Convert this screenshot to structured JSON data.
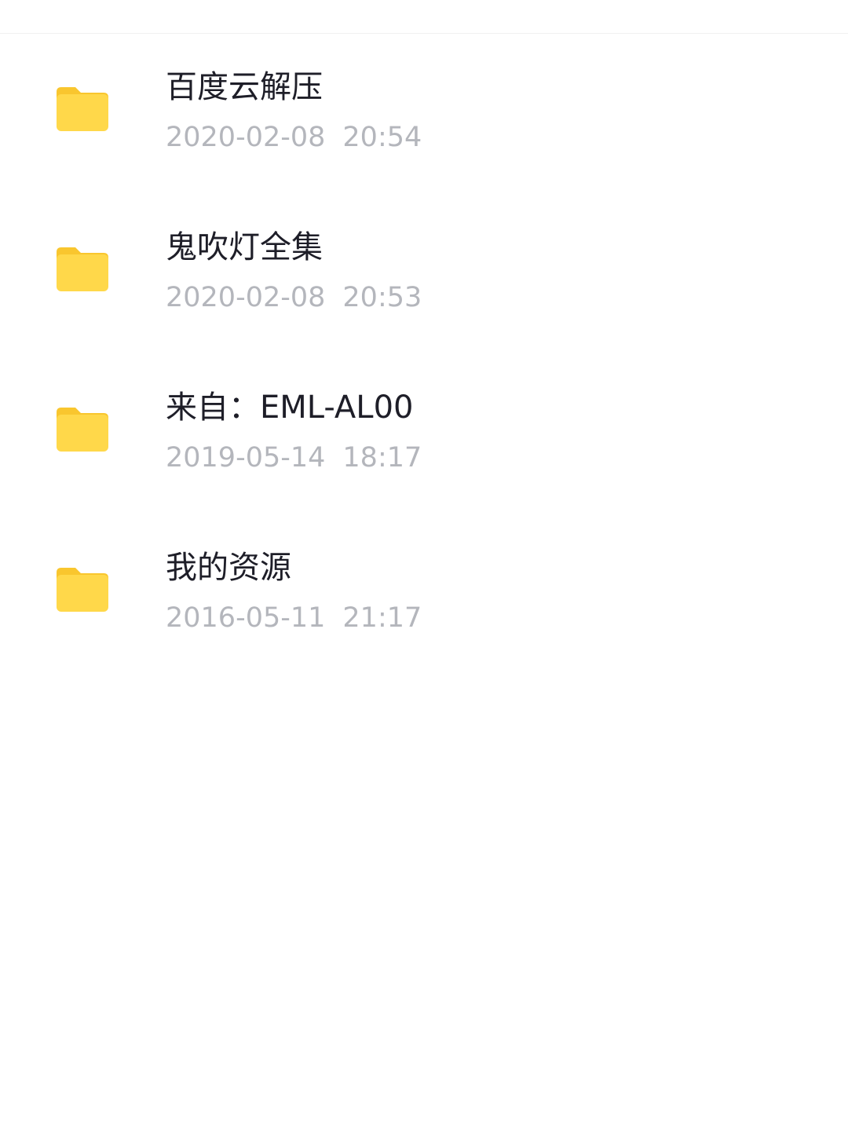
{
  "files": [
    {
      "name": "百度云解压",
      "date": "2020-02-08",
      "time": "20:54",
      "icon": "folder-icon"
    },
    {
      "name": "鬼吹灯全集",
      "date": "2020-02-08",
      "time": "20:53",
      "icon": "folder-icon"
    },
    {
      "name": "来自：EML-AL00",
      "date": "2019-05-14",
      "time": "18:17",
      "icon": "folder-icon"
    },
    {
      "name": "我的资源",
      "date": "2016-05-11",
      "time": "21:17",
      "icon": "folder-icon"
    }
  ],
  "colors": {
    "folder": "#FFD84A",
    "folder_tab": "#F9C62E",
    "name_text": "#1E1E28",
    "meta_text": "#B4B6BC"
  }
}
